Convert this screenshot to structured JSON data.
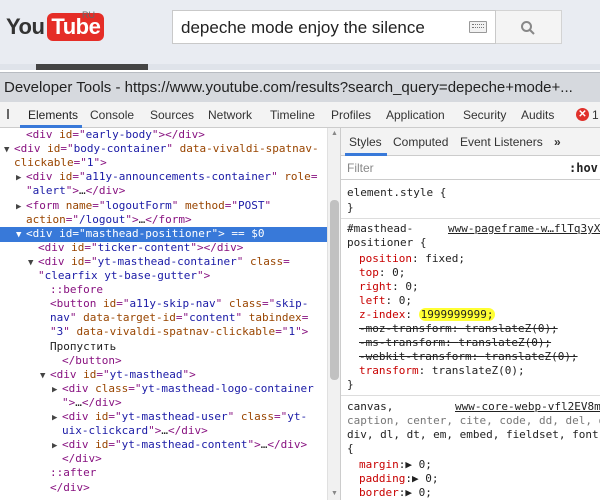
{
  "youtube": {
    "logo_you": "You",
    "logo_tube": "Tube",
    "region": "RU",
    "search_query": "depeche mode enjoy the silence"
  },
  "devtools": {
    "title": "Developer Tools - https://www.youtube.com/results?search_query=depeche+mode+...",
    "tabs": [
      "Elements",
      "Console",
      "Sources",
      "Network",
      "Timeline",
      "Profiles",
      "Application",
      "Security",
      "Audits"
    ],
    "error_count": "1"
  },
  "dom_lines": [
    {
      "indent": 1,
      "tri": "",
      "parts": [
        [
          "tag",
          "<div "
        ],
        [
          "attr",
          "id"
        ],
        [
          "tag",
          "=\""
        ],
        [
          "val",
          "early-body"
        ],
        [
          "tag",
          "\"></div>"
        ]
      ]
    },
    {
      "indent": 0,
      "tri": "▼",
      "parts": [
        [
          "tag",
          "<div "
        ],
        [
          "attr",
          "id"
        ],
        [
          "tag",
          "=\""
        ],
        [
          "val",
          "body-container"
        ],
        [
          "tag",
          "\" "
        ],
        [
          "attr",
          "data-vivaldi-spatnav-"
        ]
      ]
    },
    {
      "indent": 0,
      "tri": "",
      "parts": [
        [
          "attr",
          "clickable"
        ],
        [
          "tag",
          "=\""
        ],
        [
          "val",
          "1"
        ],
        [
          "tag",
          "\">"
        ]
      ]
    },
    {
      "indent": 1,
      "tri": "▶",
      "parts": [
        [
          "tag",
          "<div "
        ],
        [
          "attr",
          "id"
        ],
        [
          "tag",
          "=\""
        ],
        [
          "val",
          "a11y-announcements-container"
        ],
        [
          "tag",
          "\" "
        ],
        [
          "attr",
          "role"
        ],
        [
          "tag",
          "="
        ]
      ]
    },
    {
      "indent": 1,
      "tri": "",
      "parts": [
        [
          "tag",
          "\""
        ],
        [
          "val",
          "alert"
        ],
        [
          "tag",
          "\">"
        ],
        [
          "txt",
          "…"
        ],
        [
          "tag",
          "</div>"
        ]
      ]
    },
    {
      "indent": 1,
      "tri": "▶",
      "parts": [
        [
          "tag",
          "<form "
        ],
        [
          "attr",
          "name"
        ],
        [
          "tag",
          "=\""
        ],
        [
          "val",
          "logoutForm"
        ],
        [
          "tag",
          "\" "
        ],
        [
          "attr",
          "method"
        ],
        [
          "tag",
          "=\""
        ],
        [
          "val",
          "POST"
        ],
        [
          "tag",
          "\""
        ]
      ]
    },
    {
      "indent": 1,
      "tri": "",
      "parts": [
        [
          "attr",
          "action"
        ],
        [
          "tag",
          "=\""
        ],
        [
          "val",
          "/logout"
        ],
        [
          "tag",
          "\">"
        ],
        [
          "txt",
          "…"
        ],
        [
          "tag",
          "</form>"
        ]
      ]
    },
    {
      "indent": 1,
      "tri": "▼",
      "selected": true,
      "parts": [
        [
          "tag",
          "<div "
        ],
        [
          "attr",
          "id"
        ],
        [
          "tag",
          "=\""
        ],
        [
          "val",
          "masthead-positioner"
        ],
        [
          "tag",
          "\">"
        ],
        [
          "txt",
          " == $0"
        ]
      ]
    },
    {
      "indent": 2,
      "tri": "",
      "parts": [
        [
          "tag",
          "<div "
        ],
        [
          "attr",
          "id"
        ],
        [
          "tag",
          "=\""
        ],
        [
          "val",
          "ticker-content"
        ],
        [
          "tag",
          "\"></div>"
        ]
      ]
    },
    {
      "indent": 2,
      "tri": "▼",
      "parts": [
        [
          "tag",
          "<div "
        ],
        [
          "attr",
          "id"
        ],
        [
          "tag",
          "=\""
        ],
        [
          "val",
          "yt-masthead-container"
        ],
        [
          "tag",
          "\" "
        ],
        [
          "attr",
          "class"
        ],
        [
          "tag",
          "="
        ]
      ]
    },
    {
      "indent": 2,
      "tri": "",
      "parts": [
        [
          "tag",
          "\""
        ],
        [
          "val",
          "clearfix yt-base-gutter"
        ],
        [
          "tag",
          "\">"
        ]
      ]
    },
    {
      "indent": 3,
      "tri": "",
      "parts": [
        [
          "pseudo",
          "::before"
        ]
      ]
    },
    {
      "indent": 3,
      "tri": "",
      "parts": [
        [
          "tag",
          "<button "
        ],
        [
          "attr",
          "id"
        ],
        [
          "tag",
          "=\""
        ],
        [
          "val",
          "a11y-skip-nav"
        ],
        [
          "tag",
          "\" "
        ],
        [
          "attr",
          "class"
        ],
        [
          "tag",
          "=\""
        ],
        [
          "val",
          "skip-"
        ]
      ]
    },
    {
      "indent": 3,
      "tri": "",
      "parts": [
        [
          "val",
          "nav"
        ],
        [
          "tag",
          "\" "
        ],
        [
          "attr",
          "data-target-id"
        ],
        [
          "tag",
          "=\""
        ],
        [
          "val",
          "content"
        ],
        [
          "tag",
          "\" "
        ],
        [
          "attr",
          "tabindex"
        ],
        [
          "tag",
          "="
        ]
      ]
    },
    {
      "indent": 3,
      "tri": "",
      "parts": [
        [
          "tag",
          "\""
        ],
        [
          "val",
          "3"
        ],
        [
          "tag",
          "\" "
        ],
        [
          "attr",
          "data-vivaldi-spatnav-clickable"
        ],
        [
          "tag",
          "=\""
        ],
        [
          "val",
          "1"
        ],
        [
          "tag",
          "\">"
        ]
      ]
    },
    {
      "indent": 3,
      "tri": "",
      "parts": [
        [
          "txt",
          "Пропустить"
        ]
      ]
    },
    {
      "indent": 4,
      "tri": "",
      "parts": [
        [
          "tag",
          "</button>"
        ]
      ]
    },
    {
      "indent": 3,
      "tri": "▼",
      "parts": [
        [
          "tag",
          "<div "
        ],
        [
          "attr",
          "id"
        ],
        [
          "tag",
          "=\""
        ],
        [
          "val",
          "yt-masthead"
        ],
        [
          "tag",
          "\">"
        ]
      ]
    },
    {
      "indent": 4,
      "tri": "▶",
      "parts": [
        [
          "tag",
          "<div "
        ],
        [
          "attr",
          "class"
        ],
        [
          "tag",
          "=\""
        ],
        [
          "val",
          "yt-masthead-logo-container"
        ]
      ]
    },
    {
      "indent": 4,
      "tri": "",
      "parts": [
        [
          "tag",
          "\">"
        ],
        [
          "txt",
          "…"
        ],
        [
          "tag",
          "</div>"
        ]
      ]
    },
    {
      "indent": 4,
      "tri": "▶",
      "parts": [
        [
          "tag",
          "<div "
        ],
        [
          "attr",
          "id"
        ],
        [
          "tag",
          "=\""
        ],
        [
          "val",
          "yt-masthead-user"
        ],
        [
          "tag",
          "\" "
        ],
        [
          "attr",
          "class"
        ],
        [
          "tag",
          "=\""
        ],
        [
          "val",
          "yt-"
        ]
      ]
    },
    {
      "indent": 4,
      "tri": "",
      "parts": [
        [
          "val",
          "uix-clickcard"
        ],
        [
          "tag",
          "\">"
        ],
        [
          "txt",
          "…"
        ],
        [
          "tag",
          "</div>"
        ]
      ]
    },
    {
      "indent": 4,
      "tri": "▶",
      "parts": [
        [
          "tag",
          "<div "
        ],
        [
          "attr",
          "id"
        ],
        [
          "tag",
          "=\""
        ],
        [
          "val",
          "yt-masthead-content"
        ],
        [
          "tag",
          "\">"
        ],
        [
          "txt",
          "…"
        ],
        [
          "tag",
          "</div>"
        ]
      ]
    },
    {
      "indent": 4,
      "tri": "",
      "parts": [
        [
          "tag",
          "</div>"
        ]
      ]
    },
    {
      "indent": 3,
      "tri": "",
      "parts": [
        [
          "pseudo",
          "::after"
        ]
      ]
    },
    {
      "indent": 3,
      "tri": "",
      "parts": [
        [
          "tag",
          "</div>"
        ]
      ]
    }
  ],
  "styles": {
    "tabs": [
      "Styles",
      "Computed",
      "Event Listeners"
    ],
    "more": "»",
    "filter_placeholder": "Filter",
    "hov": ":hov",
    "element_style": "element.style {",
    "close_brace": "}",
    "rule1_selector_a": "#masthead-",
    "rule1_selector_b": "positioner {",
    "rule1_source": "www-pageframe-w…flTq3yX",
    "rule1_props": [
      {
        "name": "position",
        "value": "fixed;",
        "strike": false
      },
      {
        "name": "top",
        "value": "0;",
        "strike": false
      },
      {
        "name": "right",
        "value": "0;",
        "strike": false
      },
      {
        "name": "left",
        "value": "0;",
        "strike": false
      },
      {
        "name": "z-index",
        "value": "1999999999;",
        "strike": false,
        "highlight": true
      },
      {
        "name": "-moz-transform",
        "value": "translateZ(0);",
        "strike": true
      },
      {
        "name": "-ms-transform",
        "value": "translateZ(0);",
        "strike": true
      },
      {
        "name": "-webkit-transform",
        "value": "translateZ(0);",
        "strike": true
      },
      {
        "name": "transform",
        "value": "translateZ(0);",
        "strike": false
      }
    ],
    "rule2_selector_a": "canvas,",
    "rule2_source": "www-core-webp-vfl2EV8m",
    "rule2_selector_b": "caption, center, cite, code, dd, del, dfn,",
    "rule2_selector_c": "div, dl, dt, em, embed, fieldset, font, f",
    "rule2_open": "{",
    "rule2_props": [
      {
        "name": "margin",
        "value": "0;"
      },
      {
        "name": "padding",
        "value": "0;"
      },
      {
        "name": "border",
        "value": "0;"
      }
    ]
  }
}
